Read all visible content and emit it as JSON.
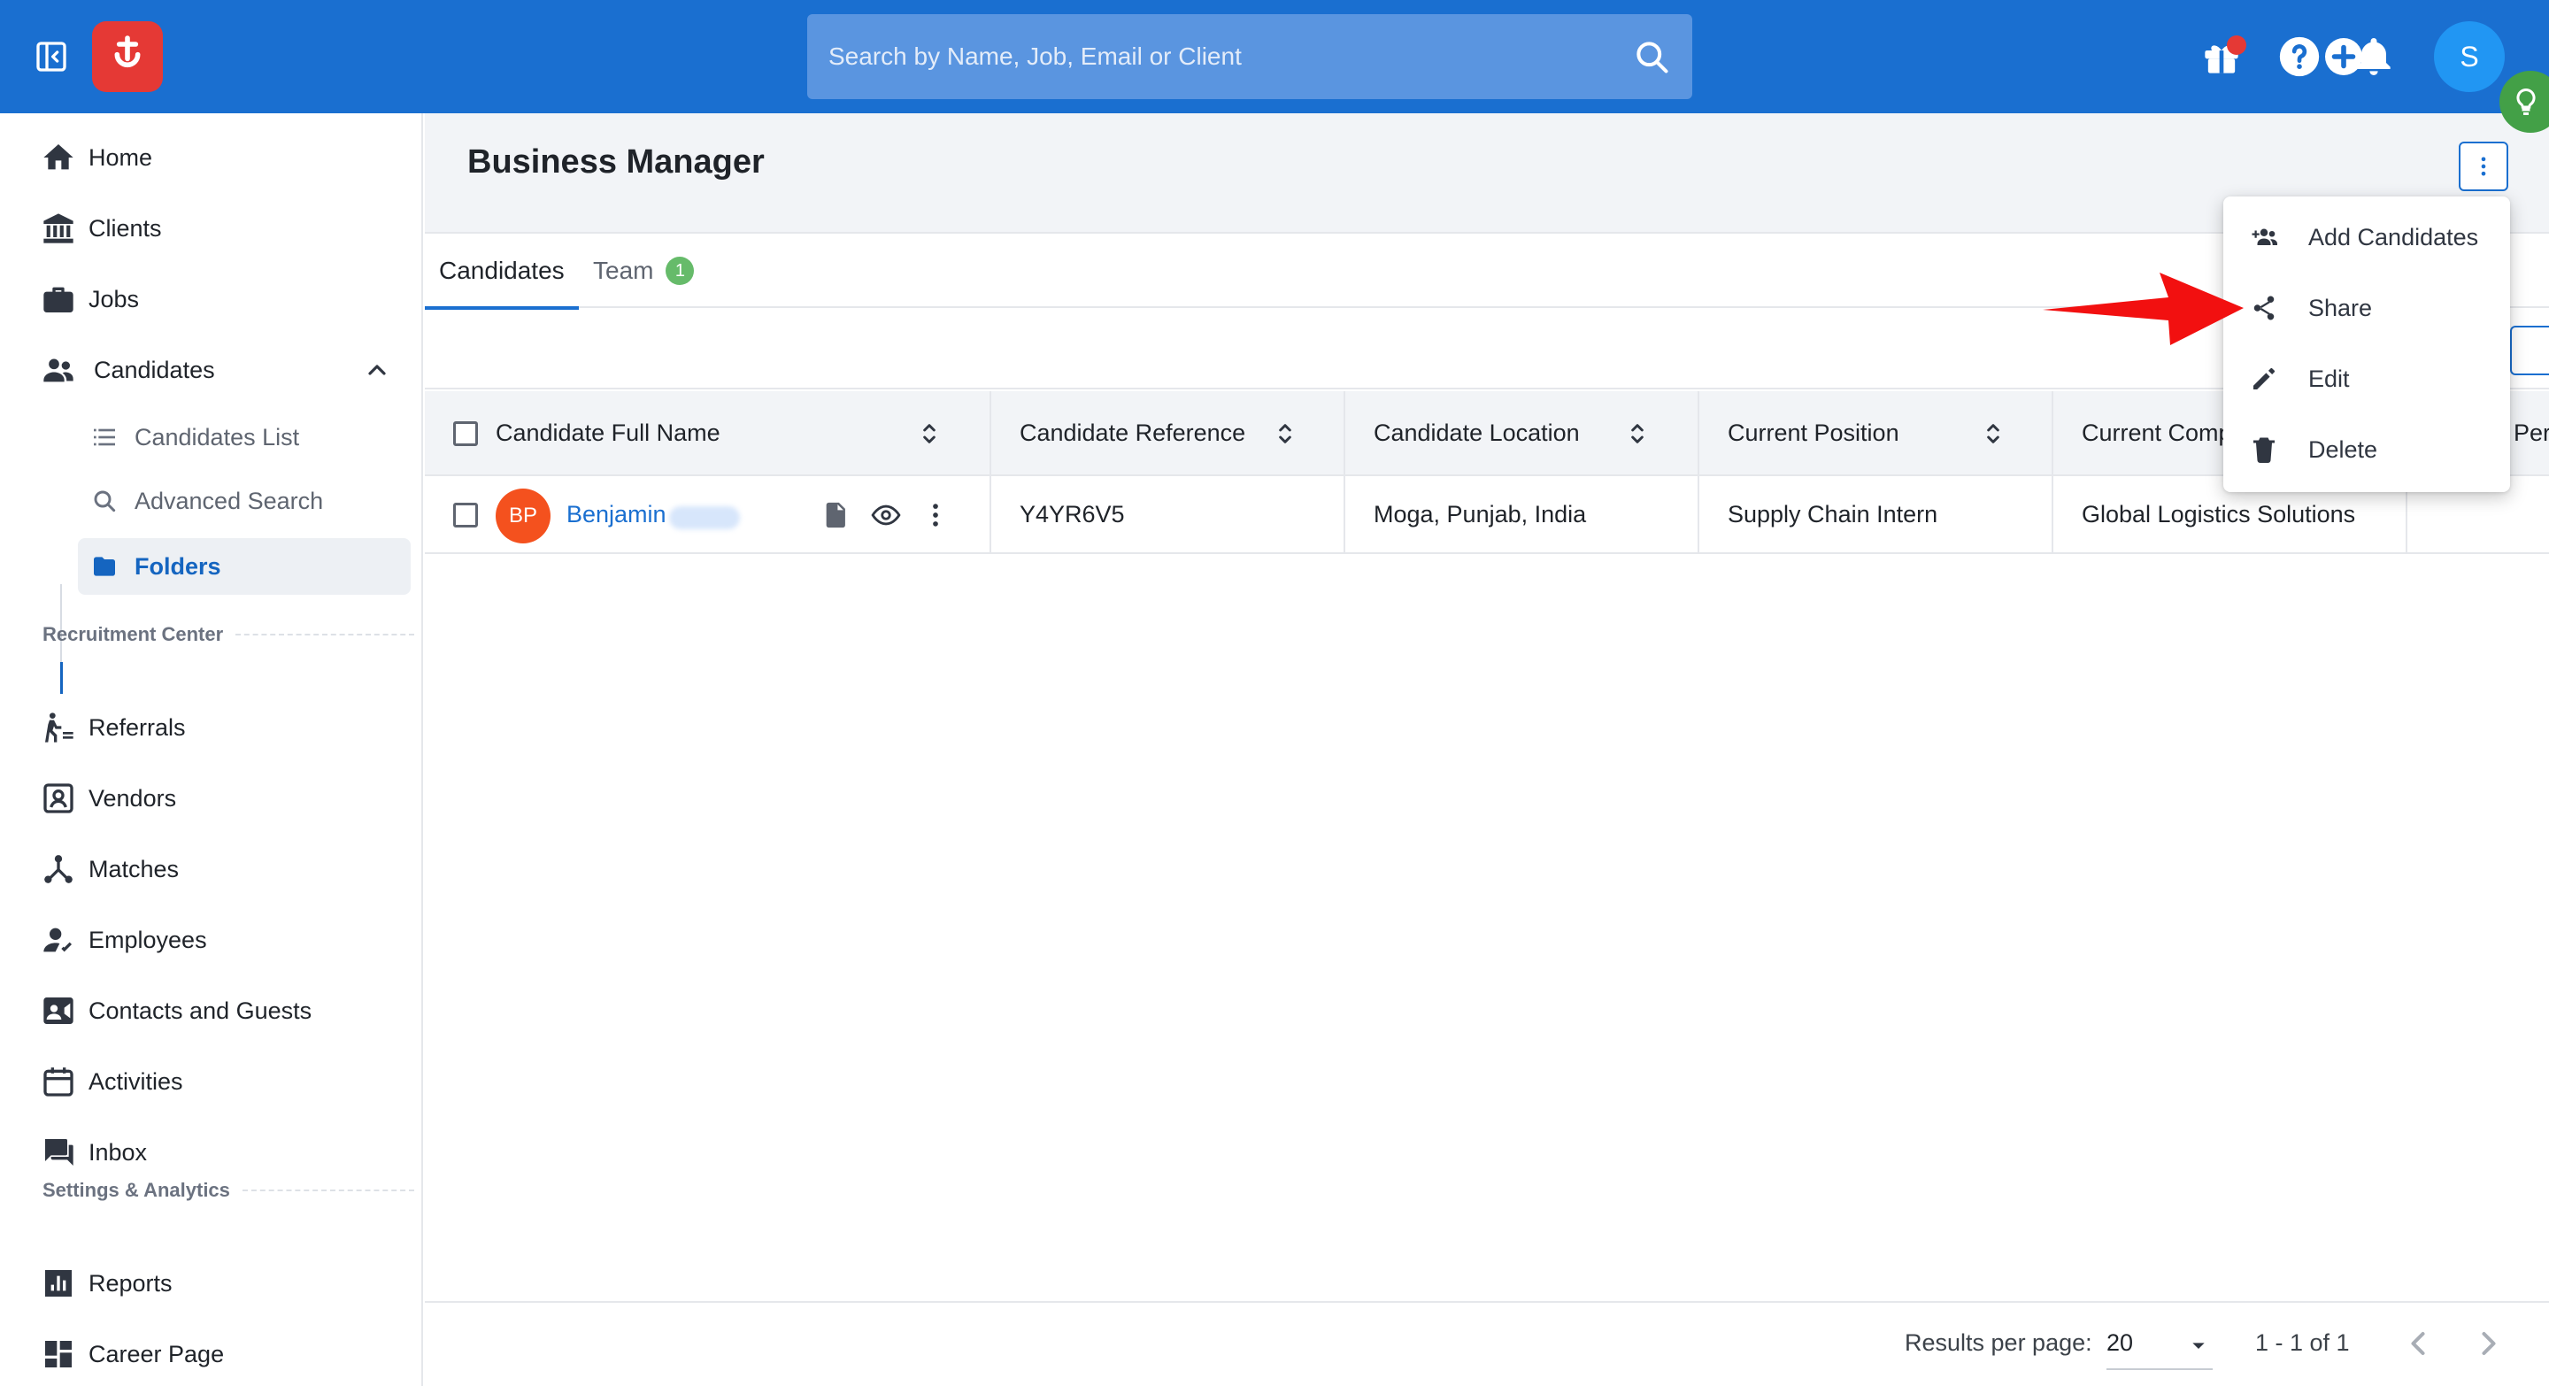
{
  "topbar": {
    "search_placeholder": "Search by Name, Job, Email or Client",
    "avatar_initial": "S",
    "icons": [
      "sidebar-toggle-icon",
      "add-icon",
      "gift-icon",
      "help-icon",
      "bell-icon"
    ]
  },
  "sidebar": {
    "items": [
      {
        "label": "Home",
        "icon": "home-icon"
      },
      {
        "label": "Clients",
        "icon": "bank-icon"
      },
      {
        "label": "Jobs",
        "icon": "briefcase-icon"
      },
      {
        "label": "Candidates",
        "icon": "people-icon"
      }
    ],
    "candidates_sub": [
      {
        "label": "Candidates List",
        "icon": "list-icon"
      },
      {
        "label": "Advanced Search",
        "icon": "search-icon"
      },
      {
        "label": "Folders",
        "icon": "folder-icon",
        "active": true
      }
    ],
    "section_recruitment": "Recruitment Center",
    "recruitment_items": [
      {
        "label": "Referrals",
        "icon": "referral-icon"
      },
      {
        "label": "Vendors",
        "icon": "vendor-icon"
      },
      {
        "label": "Matches",
        "icon": "matches-icon"
      },
      {
        "label": "Employees",
        "icon": "employee-icon"
      },
      {
        "label": "Contacts and Guests",
        "icon": "contacts-icon"
      },
      {
        "label": "Activities",
        "icon": "calendar-icon"
      },
      {
        "label": "Inbox",
        "icon": "inbox-icon"
      }
    ],
    "section_settings": "Settings & Analytics",
    "settings_items": [
      {
        "label": "Reports",
        "icon": "reports-icon"
      },
      {
        "label": "Career Page",
        "icon": "career-page-icon"
      }
    ]
  },
  "main": {
    "title": "Business Manager",
    "tabs": [
      {
        "label": "Candidates",
        "active": true
      },
      {
        "label": "Team",
        "badge": "1"
      }
    ],
    "table": {
      "columns": [
        "Candidate Full Name",
        "Candidate Reference",
        "Candidate Location",
        "Current Position",
        "Current Comp",
        "Per"
      ],
      "rows": [
        {
          "initials": "BP",
          "name": "Benjamin",
          "reference": "Y4YR6V5",
          "location": "Moga, Punjab, India",
          "position": "Supply Chain Intern",
          "company": "Global Logistics Solutions"
        }
      ]
    },
    "pagination": {
      "label": "Results per page:",
      "per_page": "20",
      "range": "1 - 1 of 1"
    }
  },
  "menu": {
    "items": [
      {
        "label": "Add Candidates",
        "icon": "add-people-icon"
      },
      {
        "label": "Share",
        "icon": "share-icon"
      },
      {
        "label": "Edit",
        "icon": "pencil-icon"
      },
      {
        "label": "Delete",
        "icon": "trash-icon"
      }
    ]
  },
  "colors": {
    "brand_blue": "#1a6fd0",
    "logo_red": "#e53935",
    "avatar_orange": "#f4511e",
    "badge_green": "#66bb6a",
    "annotation_red": "#f21010"
  }
}
